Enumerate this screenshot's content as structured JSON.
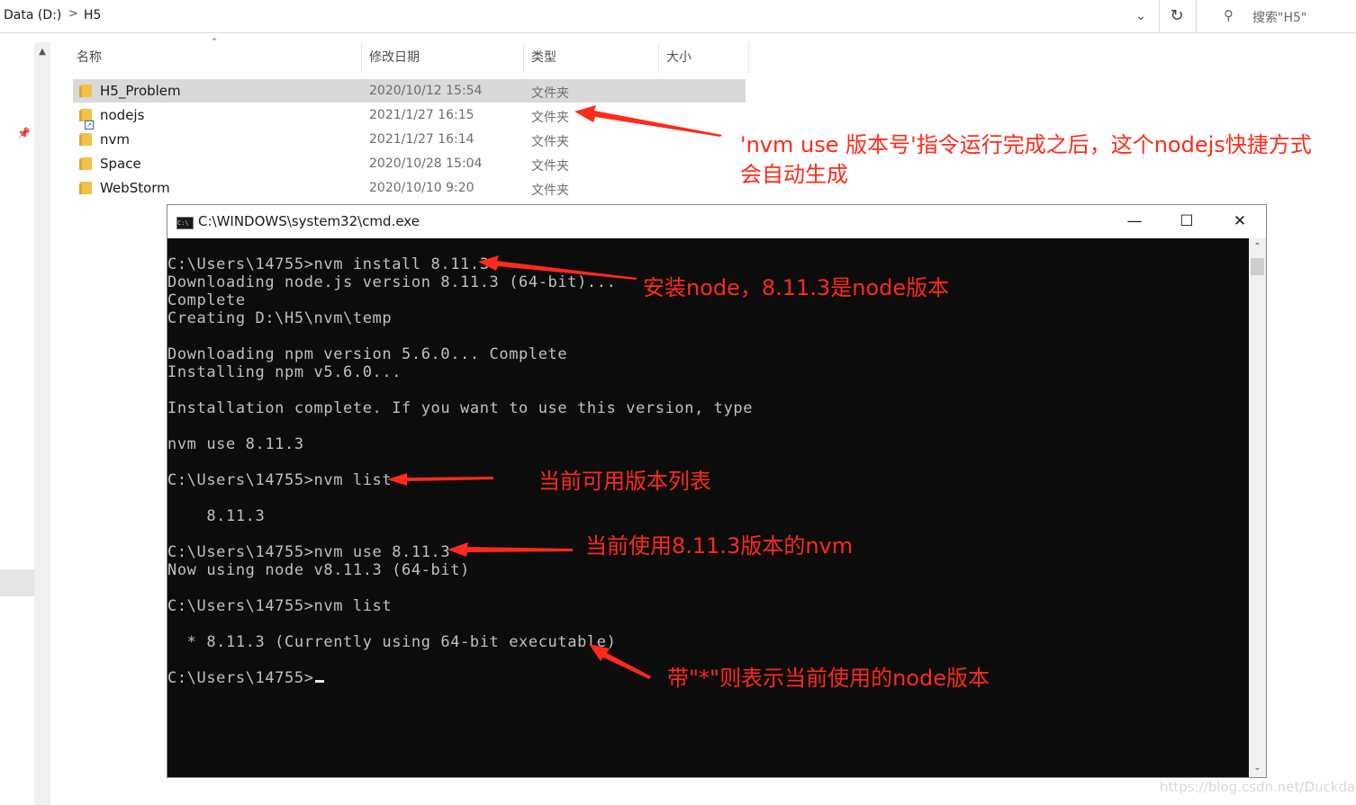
{
  "address_bar": {
    "crumbs": [
      "Data (D:)",
      "H5"
    ],
    "separator": ">",
    "search_placeholder": "搜索\"H5\""
  },
  "columns": [
    "名称",
    "修改日期",
    "类型",
    "大小"
  ],
  "files": [
    {
      "name": "H5_Problem",
      "date": "2020/10/12 15:54",
      "type": "文件夹",
      "selected": true
    },
    {
      "name": "nodejs",
      "date": "2021/1/27 16:15",
      "type": "文件夹",
      "shortcut": true
    },
    {
      "name": "nvm",
      "date": "2021/1/27 16:14",
      "type": "文件夹"
    },
    {
      "name": "Space",
      "date": "2020/10/28 15:04",
      "type": "文件夹"
    },
    {
      "name": "WebStorm",
      "date": "2020/10/10 9:20",
      "type": "文件夹"
    }
  ],
  "cmd": {
    "title": "C:\\WINDOWS\\system32\\cmd.exe",
    "lines": [
      "C:\\Users\\14755>nvm install 8.11.3",
      "Downloading node.js version 8.11.3 (64-bit)...",
      "Complete",
      "Creating D:\\H5\\nvm\\temp",
      "",
      "Downloading npm version 5.6.0... Complete",
      "Installing npm v5.6.0...",
      "",
      "Installation complete. If you want to use this version, type",
      "",
      "nvm use 8.11.3",
      "",
      "C:\\Users\\14755>nvm list",
      "",
      "    8.11.3",
      "",
      "C:\\Users\\14755>nvm use 8.11.3",
      "Now using node v8.11.3 (64-bit)",
      "",
      "C:\\Users\\14755>nvm list",
      "",
      "  * 8.11.3 (Currently using 64-bit executable)",
      "",
      "C:\\Users\\14755>"
    ]
  },
  "annotations": {
    "shortcut_line1": "'nvm use 版本号'指令运行完成之后，这个nodejs快捷方式",
    "shortcut_line2": "会自动生成",
    "install": "安装node，8.11.3是node版本",
    "list": "当前可用版本列表",
    "use": "当前使用8.11.3版本的nvm",
    "star": "带\"*\"则表示当前使用的node版本"
  },
  "colors": {
    "annotation": "#ff2a1a",
    "console_bg": "#0c0c0c",
    "console_text": "#c0c0c0"
  },
  "watermark": "https://blog.csdn.net/Duckdan"
}
